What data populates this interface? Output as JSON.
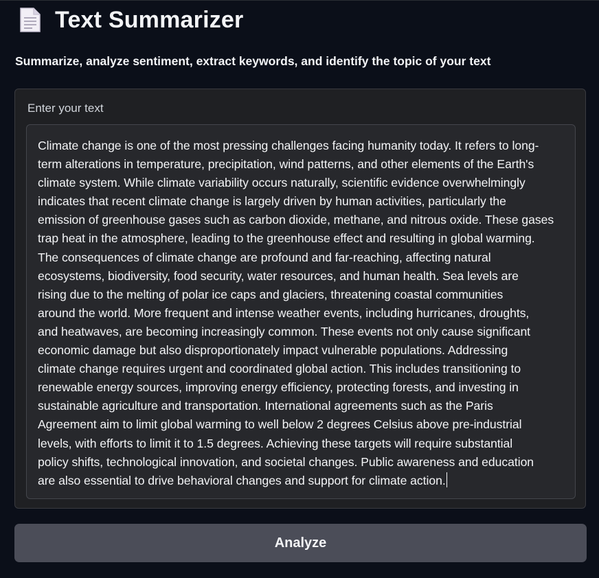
{
  "header": {
    "icon": "page-document-icon",
    "title": "Text Summarizer",
    "subtitle": "Summarize, analyze sentiment, extract keywords, and identify the topic of your text"
  },
  "input": {
    "label": "Enter your text",
    "value": "Climate change is one of the most pressing challenges facing humanity today. It refers to long-\nterm alterations in temperature, precipitation, wind patterns, and other elements of the Earth's\nclimate system. While climate variability occurs naturally, scientific evidence overwhelmingly\nindicates that recent climate change is largely driven by human activities, particularly the\nemission of greenhouse gases such as carbon dioxide, methane, and nitrous oxide. These gases\ntrap heat in the atmosphere, leading to the greenhouse effect and resulting in global warming.\nThe consequences of climate change are profound and far-reaching, affecting natural\necosystems, biodiversity, food security, water resources, and human health. Sea levels are\nrising due to the melting of polar ice caps and glaciers, threatening coastal communities\naround the world. More frequent and intense weather events, including hurricanes, droughts,\nand heatwaves, are becoming increasingly common. These events not only cause significant\neconomic damage but also disproportionately impact vulnerable populations. Addressing\nclimate change requires urgent and coordinated global action. This includes transitioning to\nrenewable energy sources, improving energy efficiency, protecting forests, and investing in\nsustainable agriculture and transportation. International agreements such as the Paris\nAgreement aim to limit global warming to well below 2 degrees Celsius above pre-industrial\nlevels, with efforts to limit it to 1.5 degrees. Achieving these targets will require substantial\npolicy shifts, technological innovation, and societal changes. Public awareness and education\nare also essential to drive behavioral changes and support for climate action."
  },
  "actions": {
    "analyze_label": "Analyze"
  },
  "colors": {
    "background": "#0b0f19",
    "panel": "#1f2023",
    "textarea": "#27282c",
    "button": "#4b4d58",
    "text": "#f3f4f6"
  }
}
